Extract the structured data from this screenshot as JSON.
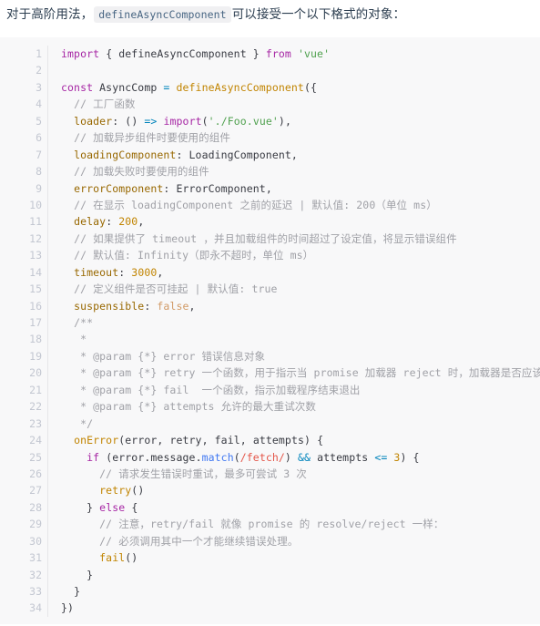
{
  "intro": {
    "before": "对于高阶用法，",
    "inline_code": "defineAsyncComponent",
    "after": "可以接受一个以下格式的对象："
  },
  "code_block": {
    "language": "js",
    "line_numbers": [
      "1",
      "2",
      "3",
      "4",
      "5",
      "6",
      "7",
      "8",
      "9",
      "10",
      "11",
      "12",
      "13",
      "14",
      "15",
      "16",
      "17",
      "18",
      "19",
      "20",
      "21",
      "22",
      "23",
      "24",
      "25",
      "26",
      "27",
      "28",
      "29",
      "30",
      "31",
      "32",
      "33",
      "34"
    ],
    "lines": [
      "import { defineAsyncComponent } from 'vue'",
      "",
      "const AsyncComp = defineAsyncComponent({",
      "  // 工厂函数",
      "  loader: () => import('./Foo.vue'),",
      "  // 加载异步组件时要使用的组件",
      "  loadingComponent: LoadingComponent,",
      "  // 加载失败时要使用的组件",
      "  errorComponent: ErrorComponent,",
      "  // 在显示 loadingComponent 之前的延迟 | 默认值: 200（单位 ms）",
      "  delay: 200,",
      "  // 如果提供了 timeout ，并且加载组件的时间超过了设定值，将显示错误组件",
      "  // 默认值: Infinity（即永不超时，单位 ms）",
      "  timeout: 3000,",
      "  // 定义组件是否可挂起 | 默认值: true",
      "  suspensible: false,",
      "  /**",
      "   *",
      "   * @param {*} error 错误信息对象",
      "   * @param {*} retry 一个函数，用于指示当 promise 加载器 reject 时，加载器是否应该重试",
      "   * @param {*} fail  一个函数，指示加载程序结束退出",
      "   * @param {*} attempts 允许的最大重试次数",
      "   */",
      "  onError(error, retry, fail, attempts) {",
      "    if (error.message.match(/fetch/) && attempts <= 3) {",
      "      // 请求发生错误时重试，最多可尝试 3 次",
      "      retry()",
      "    } else {",
      "      // 注意，retry/fail 就像 promise 的 resolve/reject 一样：",
      "      // 必须调用其中一个才能继续错误处理。",
      "      fail()",
      "    }",
      "  }",
      "})"
    ]
  },
  "colors": {
    "page_background": "#ffffff",
    "code_background": "#f8f8f9",
    "gutter_text": "#c3c7d1",
    "gutter_divider": "#e6e6e9",
    "text": "#2c3e50",
    "code_text": "#383a42",
    "keyword": "#a626a4",
    "string": "#50a14f",
    "comment": "#a0a1a7",
    "property": "#986801",
    "number": "#c18401",
    "boolean": "#d19a66",
    "function": "#c18401",
    "method": "#4078f2",
    "operator": "#0184bc",
    "regex": "#e45649",
    "inline_code_background": "#f0f0f2",
    "inline_code_text": "#476582"
  }
}
